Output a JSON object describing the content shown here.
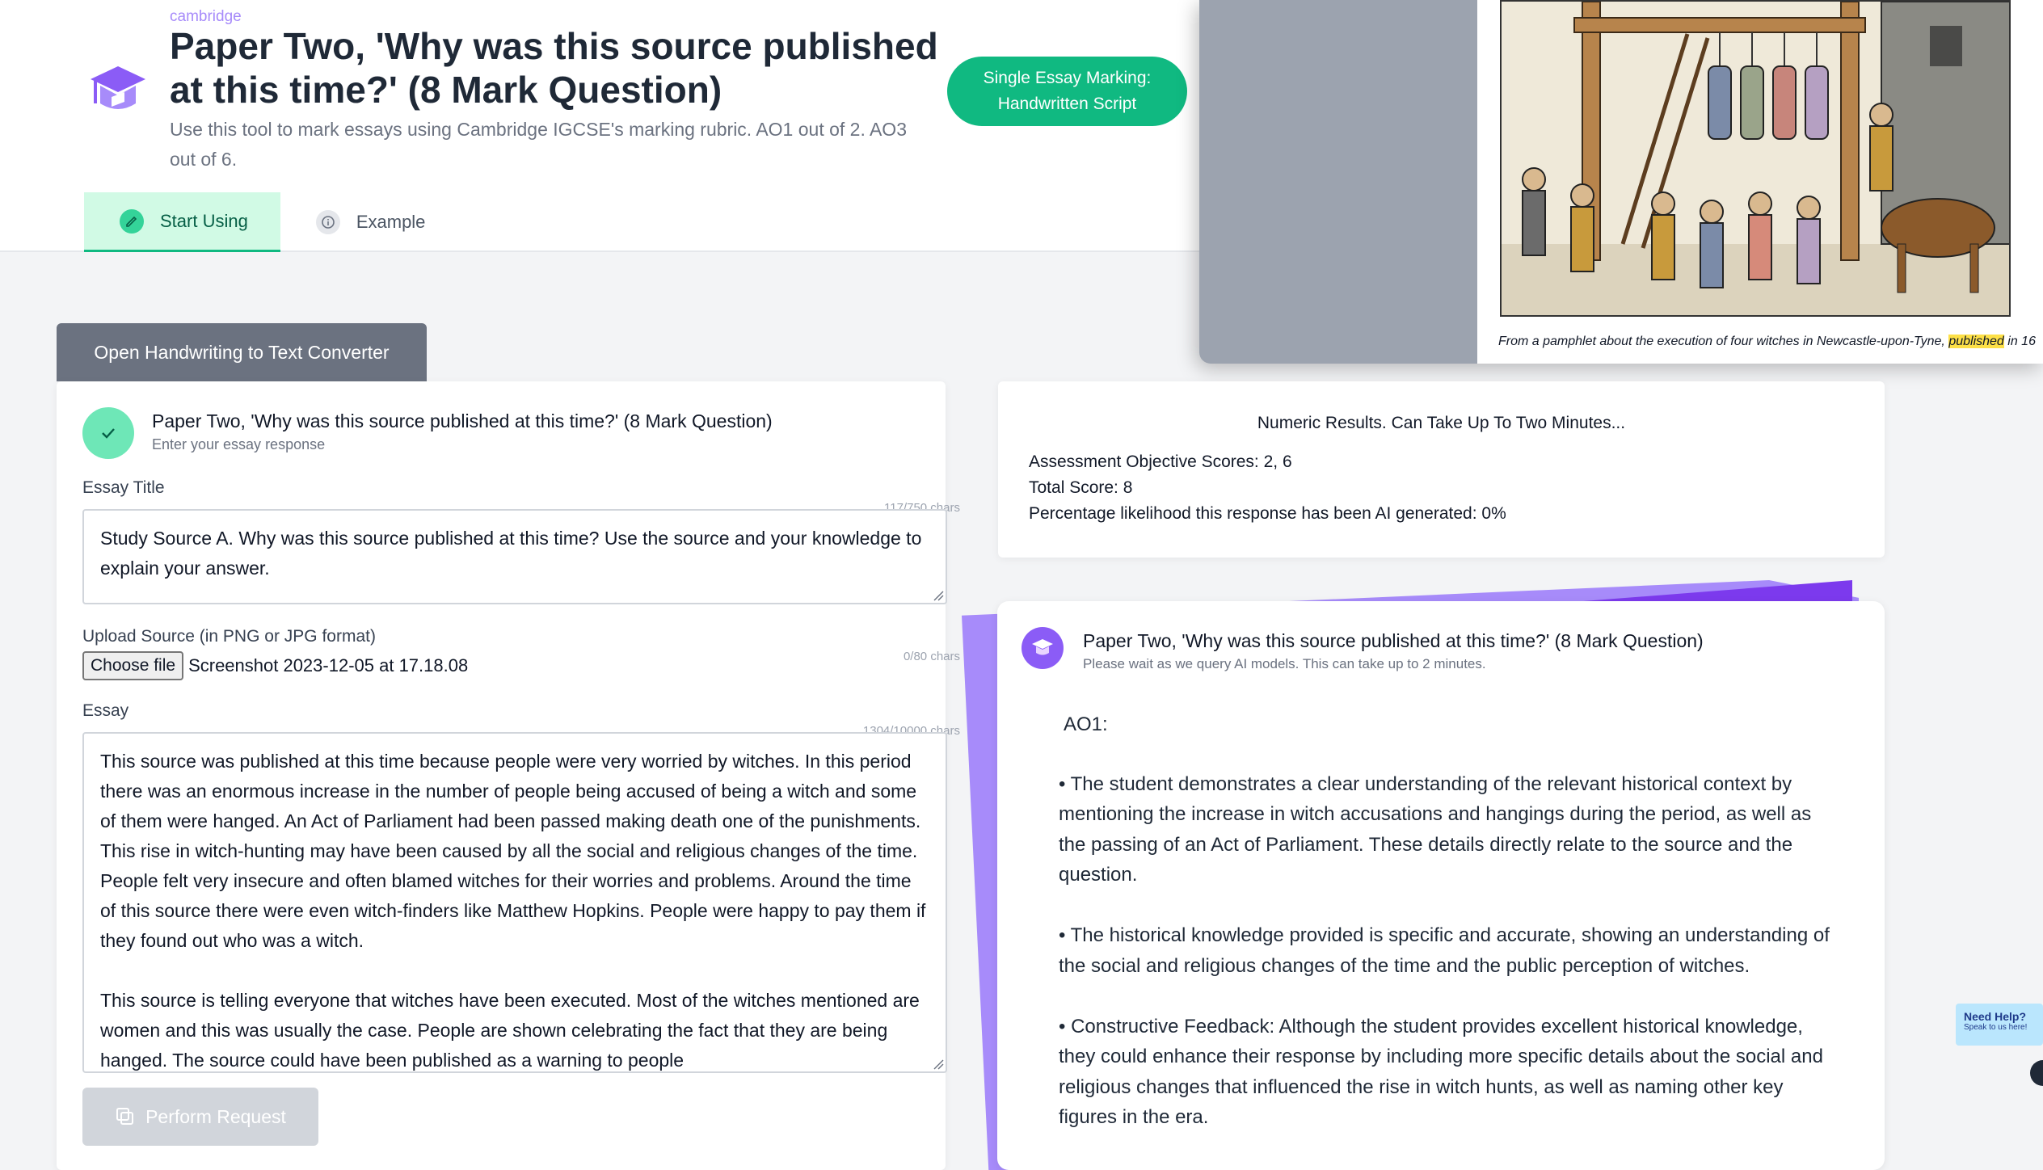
{
  "header": {
    "brand": "cambridge",
    "title": "Paper Two, 'Why was this source published at this time?' (8 Mark Question)",
    "description": "Use this tool to mark essays using Cambridge IGCSE's marking rubric. AO1 out of 2. AO3 out of 6.",
    "mode_button": "Single Essay Marking: Handwritten Script",
    "tabs": [
      {
        "label": "Start Using",
        "icon": "pencil-icon",
        "active": true
      },
      {
        "label": "Example",
        "icon": "info-icon",
        "active": false
      }
    ]
  },
  "overlay": {
    "caption_before": "From a pamphlet about the execution of four witches in Newcastle-upon-Tyne, ",
    "caption_highlight": "published",
    "caption_after": " in 16"
  },
  "converter_button": "Open Handwriting to Text Converter",
  "form": {
    "title": "Paper Two, 'Why was this source published at this time?' (8 Mark Question)",
    "subtitle": "Enter your essay response",
    "essay_title_label": "Essay Title",
    "essay_title_count": "117/750 chars",
    "essay_title_value": "Study Source A. Why was this source published at this time? Use the source and your knowledge to explain your answer.",
    "upload_label": "Upload Source (in PNG or JPG format)",
    "upload_count": "0/80 chars",
    "choose_file": "Choose file",
    "file_name": "Screenshot 2023-12-05 at 17.18.08",
    "essay_label": "Essay",
    "essay_count": "1304/10000 chars",
    "essay_p1": "This source was published at this time because people were very worried by witches. In this period there was an enormous increase in the number of people being accused of being a witch and some of them were hanged. An Act of Parliament had been passed making death one of the punishments. This rise in witch-hunting may have been caused by all the social and religious changes of the time. People felt very insecure and often blamed witches for their worries and problems. Around the time of this source there were even witch-finders like Matthew Hopkins. People were happy to pay them if they found out who was a witch.",
    "essay_p2": "This source is telling everyone that witches have been executed. Most of the witches mentioned are women and this was usually the case. People are shown celebrating the fact that they are being hanged. The source could have been published as a warning to people",
    "perform_button": "Perform Request"
  },
  "results": {
    "heading": "Numeric Results. Can Take Up To Two Minutes...",
    "ao_scores": "Assessment Objective Scores: 2, 6",
    "total": "Total Score: 8",
    "ai_likelihood": "Percentage likelihood this response has been AI generated: 0%"
  },
  "feedback": {
    "title": "Paper Two, 'Why was this source published at this time?' (8 Mark Question)",
    "subtitle": "Please wait as we query AI models. This can take up to 2 minutes.",
    "ao_heading": "AO1:",
    "point1": "• The student demonstrates a clear understanding of the relevant historical context by mentioning the increase in witch accusations and hangings during the period, as well as the passing of an Act of Parliament. These details directly relate to the source and the question.",
    "point2": "• The historical knowledge provided is specific and accurate, showing an understanding of the social and religious changes of the time and the public perception of witches.",
    "point3": "• Constructive Feedback: Although the student provides excellent historical knowledge, they could enhance their response by including more specific details about the social and religious changes that influenced the rise in witch hunts, as well as naming other key figures in the era."
  },
  "help": {
    "title": "Need Help?",
    "subtitle": "Speak to us here!"
  },
  "colors": {
    "accent_green": "#10b981",
    "accent_purple": "#8b5cf6",
    "highlight": "#fde047"
  }
}
